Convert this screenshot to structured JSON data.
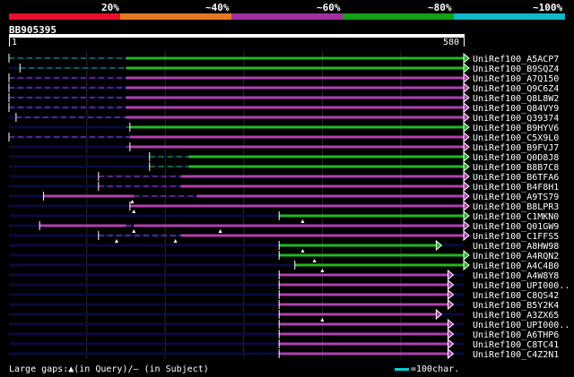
{
  "legend": {
    "labels": [
      "20%",
      "~40%",
      "~60%",
      "~80%",
      "~100%"
    ],
    "colors": [
      "#e8102c",
      "#e87820",
      "#a030a0",
      "#14a014",
      "#10b8c8"
    ]
  },
  "query": {
    "id": "BB905395",
    "start": "1",
    "end": "580"
  },
  "colors": {
    "green": "#22b822",
    "magenta": "#b040b0",
    "navy": "#0a0a40",
    "grid": "#2a2a2a",
    "gap": "#ffffff"
  },
  "chart_data": {
    "type": "alignment-map",
    "query_length": 580,
    "hits": [
      {
        "name": "UniRef100_A5ACP7",
        "color": "green",
        "start": 1,
        "end": 580,
        "shaded": [
          [
            1,
            150
          ]
        ]
      },
      {
        "name": "UniRef100_B9SQZ4",
        "color": "green",
        "start": 15,
        "end": 580,
        "shaded": [
          [
            15,
            150
          ]
        ]
      },
      {
        "name": "UniRef100_A7Q150",
        "color": "magenta",
        "start": 1,
        "end": 580,
        "shaded": [
          [
            1,
            150
          ]
        ]
      },
      {
        "name": "UniRef100_Q9C6Z4",
        "color": "magenta",
        "start": 1,
        "end": 580,
        "shaded": [
          [
            1,
            150
          ]
        ]
      },
      {
        "name": "UniRef100_Q8L8W2",
        "color": "magenta",
        "start": 1,
        "end": 580,
        "shaded": [
          [
            1,
            150
          ]
        ]
      },
      {
        "name": "UniRef100_Q84VY9",
        "color": "magenta",
        "start": 1,
        "end": 580,
        "shaded": [
          [
            1,
            150
          ]
        ]
      },
      {
        "name": "UniRef100_Q39374",
        "color": "magenta",
        "start": 10,
        "end": 580,
        "shaded": [
          [
            10,
            150
          ]
        ]
      },
      {
        "name": "UniRef100_B9HYV6",
        "color": "green",
        "start": 155,
        "end": 580,
        "shaded": [
          [
            150,
            155
          ]
        ]
      },
      {
        "name": "UniRef100_C5X9L0",
        "color": "magenta",
        "start": 1,
        "end": 580,
        "shaded": [
          [
            1,
            155
          ]
        ]
      },
      {
        "name": "UniRef100_B9FVJ7",
        "color": "magenta",
        "start": 155,
        "end": 580,
        "shaded": [
          [
            150,
            155
          ]
        ]
      },
      {
        "name": "UniRef100_Q0D8J8",
        "color": "green",
        "start": 180,
        "end": 580,
        "shaded": [
          [
            180,
            230
          ]
        ]
      },
      {
        "name": "UniRef100_B8B7C8",
        "color": "green",
        "start": 180,
        "end": 580,
        "shaded": [
          [
            180,
            230
          ]
        ]
      },
      {
        "name": "UniRef100_B6TFA6",
        "color": "magenta",
        "start": 115,
        "end": 580,
        "shaded": [
          [
            115,
            220
          ]
        ]
      },
      {
        "name": "UniRef100_B4F8H1",
        "color": "magenta",
        "start": 115,
        "end": 580,
        "shaded": [
          [
            115,
            220
          ]
        ]
      },
      {
        "name": "UniRef100_A9TS79",
        "color": "magenta",
        "start": 45,
        "end": 580,
        "shaded": [
          [
            160,
            240
          ]
        ],
        "gaps": [
          158
        ]
      },
      {
        "name": "UniRef100_B8LPR3",
        "color": "magenta",
        "start": 155,
        "end": 580,
        "shaded": [],
        "gaps": [
          160
        ]
      },
      {
        "name": "UniRef100_C1MKN0",
        "color": "green",
        "start": 345,
        "end": 580,
        "shaded": [],
        "gaps": [
          375
        ]
      },
      {
        "name": "UniRef100_Q01GW9",
        "color": "magenta",
        "start": 40,
        "end": 580,
        "shaded": [
          [
            150,
            160
          ]
        ],
        "gaps": [
          160,
          270
        ]
      },
      {
        "name": "UniRef100_C1FFS5",
        "color": "magenta",
        "start": 115,
        "end": 580,
        "shaded": [
          [
            115,
            220
          ]
        ],
        "gaps": [
          138,
          213
        ]
      },
      {
        "name": "UniRef100_A8HW98",
        "color": "green",
        "start": 345,
        "end": 545,
        "shaded": [],
        "gaps": [
          375
        ]
      },
      {
        "name": "UniRef100_A4RQN2",
        "color": "green",
        "start": 345,
        "end": 580,
        "shaded": [],
        "gaps": [
          390
        ]
      },
      {
        "name": "UniRef100_A4C4B0",
        "color": "green",
        "start": 365,
        "end": 580,
        "shaded": [],
        "gaps": [
          400
        ]
      },
      {
        "name": "UniRef100_A4W8Y8",
        "color": "magenta",
        "start": 345,
        "end": 560,
        "shaded": []
      },
      {
        "name": "UniRef100_UPI000..",
        "color": "magenta",
        "start": 345,
        "end": 560,
        "shaded": []
      },
      {
        "name": "UniRef100_C8QS42",
        "color": "magenta",
        "start": 345,
        "end": 560,
        "shaded": []
      },
      {
        "name": "UniRef100_B5Y2K4",
        "color": "magenta",
        "start": 345,
        "end": 560,
        "shaded": []
      },
      {
        "name": "UniRef100_A3ZX65",
        "color": "magenta",
        "start": 345,
        "end": 545,
        "shaded": [],
        "gaps": [
          400
        ]
      },
      {
        "name": "UniRef100_UPI000..",
        "color": "magenta",
        "start": 345,
        "end": 560,
        "shaded": []
      },
      {
        "name": "UniRef100_A6THP6",
        "color": "magenta",
        "start": 345,
        "end": 560,
        "shaded": []
      },
      {
        "name": "UniRef100_C8TC41",
        "color": "magenta",
        "start": 345,
        "end": 560,
        "shaded": []
      },
      {
        "name": "UniRef100_C4Z2N1",
        "color": "magenta",
        "start": 345,
        "end": 560,
        "shaded": []
      }
    ]
  },
  "footer": {
    "gaps_label": "Large gaps:▲(in Query)/– (in Subject)",
    "scale_label": "=100char."
  }
}
